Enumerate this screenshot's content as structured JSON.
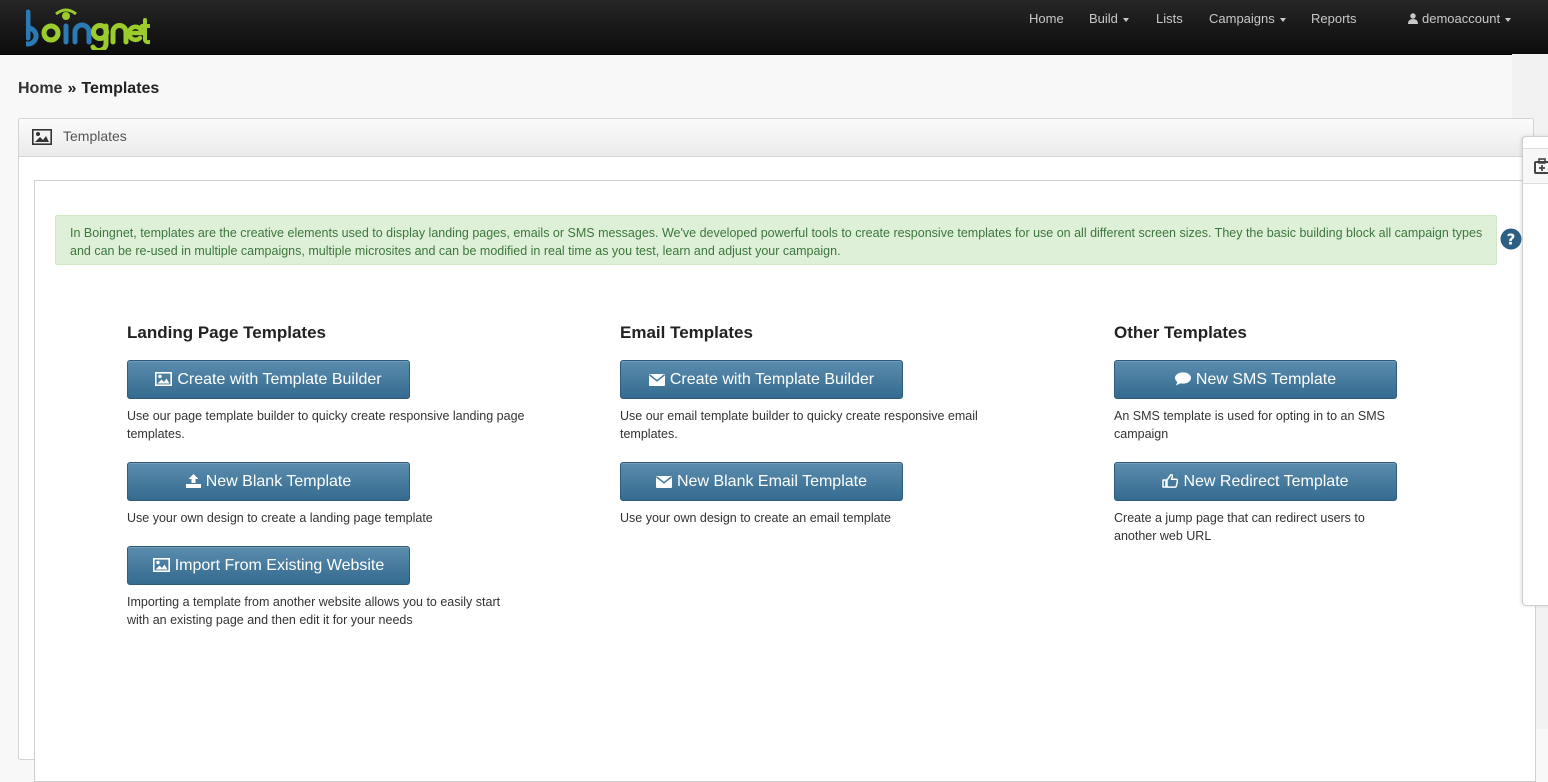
{
  "nav": {
    "logo_text": "boingnet",
    "items": [
      {
        "label": "Home",
        "dropdown": false
      },
      {
        "label": "Build",
        "dropdown": true
      },
      {
        "label": "Lists",
        "dropdown": false
      },
      {
        "label": "Campaigns",
        "dropdown": true
      },
      {
        "label": "Reports",
        "dropdown": false
      }
    ],
    "user": {
      "label": "demoaccount",
      "icon": "user-icon"
    }
  },
  "breadcrumb": {
    "home": "Home",
    "separator": "»",
    "current": "Templates"
  },
  "panel": {
    "title": "Templates",
    "icon": "picture-icon",
    "intro": "In Boingnet, templates are the creative elements used to display landing pages, emails or SMS messages. We've developed powerful tools to create responsive templates for use on all different screen sizes. They the basic building block all campaign types and can be re-used in multiple campaigns, multiple microsites and can be modified in real time as you test, learn and adjust your campaign."
  },
  "columns": [
    {
      "title": "Landing Page Templates",
      "actions": [
        {
          "label": "Create with Template Builder",
          "icon": "picture-icon",
          "desc": "Use our page template builder to quicky create responsive landing page templates."
        },
        {
          "label": "New Blank Template",
          "icon": "upload-icon",
          "desc": "Use your own design to create a landing page template"
        },
        {
          "label": "Import From Existing Website",
          "icon": "picture-icon",
          "desc": "Importing a template from another website allows you to easily start with an existing page and then edit it for your needs"
        }
      ]
    },
    {
      "title": "Email Templates",
      "actions": [
        {
          "label": "Create with Template Builder",
          "icon": "envelope-icon",
          "desc": "Use our email template builder to quicky create responsive email templates."
        },
        {
          "label": "New Blank Email Template",
          "icon": "envelope-icon",
          "desc": "Use your own design to create an email template"
        }
      ]
    },
    {
      "title": "Other Templates",
      "actions": [
        {
          "label": "New SMS Template",
          "icon": "comment-icon",
          "desc": "An SMS template is used for opting in to an SMS campaign"
        },
        {
          "label": "New Redirect Template",
          "icon": "hand-point-icon",
          "desc": "Create a jump page that can redirect users to another web URL"
        }
      ]
    }
  ],
  "colors": {
    "button": "#3f7497",
    "alert_bg": "#dff0d8",
    "alert_text": "#3c763d",
    "logo_green": "#9ccc2c",
    "logo_blue": "#2a7ab5"
  }
}
